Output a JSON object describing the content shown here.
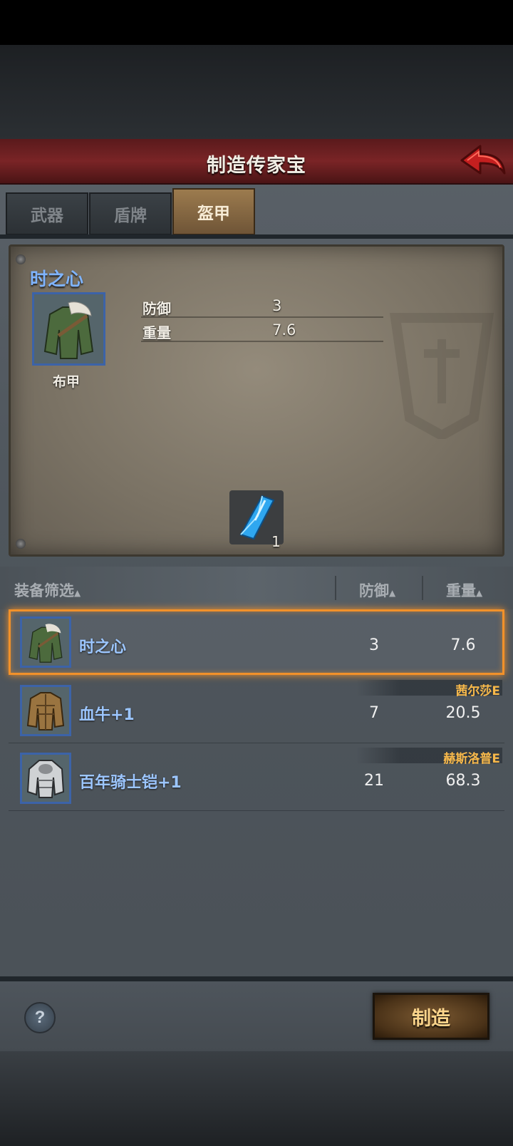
{
  "window": {
    "title": "制造传家宝"
  },
  "tabs": [
    {
      "label": "武器",
      "active": false
    },
    {
      "label": "盾牌",
      "active": false
    },
    {
      "label": "盔甲",
      "active": true
    }
  ],
  "detail": {
    "item_name": "时之心",
    "item_type": "布甲",
    "stats": [
      {
        "label": "防御",
        "value": "3"
      },
      {
        "label": "重量",
        "value": "7.6"
      }
    ],
    "material_count": "1"
  },
  "list": {
    "headers": {
      "filter": "装备筛选",
      "defense": "防御",
      "weight": "重量"
    },
    "rows": [
      {
        "name": "时之心",
        "defense": "3",
        "weight": "7.6",
        "owner": "",
        "selected": true,
        "icon": "cloth-armor-icon"
      },
      {
        "name": "血牛+1",
        "defense": "7",
        "weight": "20.5",
        "owner": "茜尔莎E",
        "selected": false,
        "icon": "leather-armor-icon"
      },
      {
        "name": "百年骑士铠+1",
        "defense": "21",
        "weight": "68.3",
        "owner": "赫斯洛普E",
        "selected": false,
        "icon": "plate-armor-icon"
      }
    ]
  },
  "footer": {
    "help_label": "?",
    "craft_label": "制造"
  },
  "colors": {
    "accent_selected": "#f2912a",
    "item_name": "#7fb4ff",
    "owner": "#f7b84a",
    "title_bar": "#7a2426"
  }
}
